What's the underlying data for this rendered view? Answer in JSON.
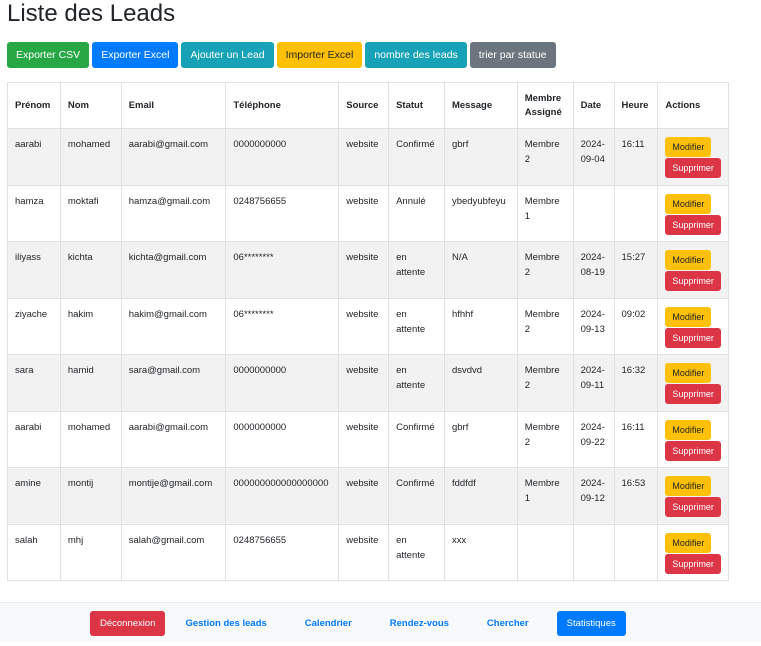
{
  "page": {
    "title": "Liste des Leads"
  },
  "toolbar": {
    "export_csv": "Exporter CSV",
    "export_excel": "Exporter Excel",
    "add_lead": "Ajouter un Lead",
    "import_excel": "Importer Excel",
    "count_leads": "nombre des leads",
    "sort_status": "trier par statue"
  },
  "table": {
    "headers": [
      "Prénom",
      "Nom",
      "Email",
      "Téléphone",
      "Source",
      "Statut",
      "Message",
      "Membre Assigné",
      "Date",
      "Heure",
      "Actions"
    ],
    "rows": [
      {
        "prenom": "aarabi",
        "nom": "mohamed",
        "email": "aarabi@gmail.com",
        "telephone": "0000000000",
        "source": "website",
        "statut": "Confirmé",
        "message": "gbrf",
        "membre": "Membre 2",
        "date": "2024-09-04",
        "heure": "16:11"
      },
      {
        "prenom": "hamza",
        "nom": "moktafi",
        "email": "hamza@gmail.com",
        "telephone": "0248756655",
        "source": "website",
        "statut": "Annulé",
        "message": "ybedyubfeyu",
        "membre": "Membre 1",
        "date": "",
        "heure": ""
      },
      {
        "prenom": "iliyass",
        "nom": "kichta",
        "email": "kichta@gmail.com",
        "telephone": "06********",
        "source": "website",
        "statut": "en attente",
        "message": "N/A",
        "membre": "Membre 2",
        "date": "2024-08-19",
        "heure": "15:27"
      },
      {
        "prenom": "ziyache",
        "nom": "hakim",
        "email": "hakim@gmail.com",
        "telephone": "06********",
        "source": "website",
        "statut": "en attente",
        "message": "hfhhf",
        "membre": "Membre 2",
        "date": "2024-09-13",
        "heure": "09:02"
      },
      {
        "prenom": "sara",
        "nom": "hamid",
        "email": "sara@gmail.com",
        "telephone": "0000000000",
        "source": "website",
        "statut": "en attente",
        "message": "dsvdvd",
        "membre": "Membre 2",
        "date": "2024-09-11",
        "heure": "16:32"
      },
      {
        "prenom": "aarabi",
        "nom": "mohamed",
        "email": "aarabi@gmail.com",
        "telephone": "0000000000",
        "source": "website",
        "statut": "Confirmé",
        "message": "gbrf",
        "membre": "Membre 2",
        "date": "2024-09-22",
        "heure": "16:11"
      },
      {
        "prenom": "amine",
        "nom": "montij",
        "email": "montije@gmail.com",
        "telephone": "000000000000000000",
        "source": "website",
        "statut": "Confirmé",
        "message": "fddfdf",
        "membre": "Membre 1",
        "date": "2024-09-12",
        "heure": "16:53"
      },
      {
        "prenom": "salah",
        "nom": "mhj",
        "email": "salah@gmail.com",
        "telephone": "0248756655",
        "source": "website",
        "statut": "en attente",
        "message": "xxx",
        "membre": "",
        "date": "",
        "heure": ""
      }
    ],
    "actions": {
      "edit": "Modifier",
      "delete": "Supprimer"
    }
  },
  "nav": {
    "logout": "Déconnexion",
    "manage_leads": "Gestion des leads",
    "calendar": "Calendrier",
    "appointments": "Rendez-vous",
    "search": "Chercher",
    "statistics": "Statistiques"
  },
  "colors": {
    "success": "#28a745",
    "primary": "#007bff",
    "info": "#17a2b8",
    "warning": "#ffc107",
    "secondary": "#6c757d",
    "danger": "#dc3545"
  }
}
